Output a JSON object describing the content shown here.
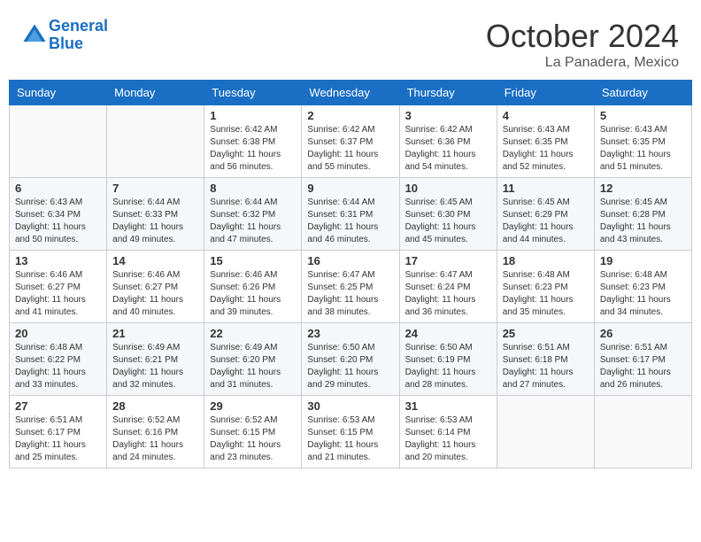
{
  "header": {
    "logo_line1": "General",
    "logo_line2": "Blue",
    "month": "October 2024",
    "location": "La Panadera, Mexico"
  },
  "days_of_week": [
    "Sunday",
    "Monday",
    "Tuesday",
    "Wednesday",
    "Thursday",
    "Friday",
    "Saturday"
  ],
  "weeks": [
    [
      {
        "day": "",
        "info": ""
      },
      {
        "day": "",
        "info": ""
      },
      {
        "day": "1",
        "info": "Sunrise: 6:42 AM\nSunset: 6:38 PM\nDaylight: 11 hours and 56 minutes."
      },
      {
        "day": "2",
        "info": "Sunrise: 6:42 AM\nSunset: 6:37 PM\nDaylight: 11 hours and 55 minutes."
      },
      {
        "day": "3",
        "info": "Sunrise: 6:42 AM\nSunset: 6:36 PM\nDaylight: 11 hours and 54 minutes."
      },
      {
        "day": "4",
        "info": "Sunrise: 6:43 AM\nSunset: 6:35 PM\nDaylight: 11 hours and 52 minutes."
      },
      {
        "day": "5",
        "info": "Sunrise: 6:43 AM\nSunset: 6:35 PM\nDaylight: 11 hours and 51 minutes."
      }
    ],
    [
      {
        "day": "6",
        "info": "Sunrise: 6:43 AM\nSunset: 6:34 PM\nDaylight: 11 hours and 50 minutes."
      },
      {
        "day": "7",
        "info": "Sunrise: 6:44 AM\nSunset: 6:33 PM\nDaylight: 11 hours and 49 minutes."
      },
      {
        "day": "8",
        "info": "Sunrise: 6:44 AM\nSunset: 6:32 PM\nDaylight: 11 hours and 47 minutes."
      },
      {
        "day": "9",
        "info": "Sunrise: 6:44 AM\nSunset: 6:31 PM\nDaylight: 11 hours and 46 minutes."
      },
      {
        "day": "10",
        "info": "Sunrise: 6:45 AM\nSunset: 6:30 PM\nDaylight: 11 hours and 45 minutes."
      },
      {
        "day": "11",
        "info": "Sunrise: 6:45 AM\nSunset: 6:29 PM\nDaylight: 11 hours and 44 minutes."
      },
      {
        "day": "12",
        "info": "Sunrise: 6:45 AM\nSunset: 6:28 PM\nDaylight: 11 hours and 43 minutes."
      }
    ],
    [
      {
        "day": "13",
        "info": "Sunrise: 6:46 AM\nSunset: 6:27 PM\nDaylight: 11 hours and 41 minutes."
      },
      {
        "day": "14",
        "info": "Sunrise: 6:46 AM\nSunset: 6:27 PM\nDaylight: 11 hours and 40 minutes."
      },
      {
        "day": "15",
        "info": "Sunrise: 6:46 AM\nSunset: 6:26 PM\nDaylight: 11 hours and 39 minutes."
      },
      {
        "day": "16",
        "info": "Sunrise: 6:47 AM\nSunset: 6:25 PM\nDaylight: 11 hours and 38 minutes."
      },
      {
        "day": "17",
        "info": "Sunrise: 6:47 AM\nSunset: 6:24 PM\nDaylight: 11 hours and 36 minutes."
      },
      {
        "day": "18",
        "info": "Sunrise: 6:48 AM\nSunset: 6:23 PM\nDaylight: 11 hours and 35 minutes."
      },
      {
        "day": "19",
        "info": "Sunrise: 6:48 AM\nSunset: 6:23 PM\nDaylight: 11 hours and 34 minutes."
      }
    ],
    [
      {
        "day": "20",
        "info": "Sunrise: 6:48 AM\nSunset: 6:22 PM\nDaylight: 11 hours and 33 minutes."
      },
      {
        "day": "21",
        "info": "Sunrise: 6:49 AM\nSunset: 6:21 PM\nDaylight: 11 hours and 32 minutes."
      },
      {
        "day": "22",
        "info": "Sunrise: 6:49 AM\nSunset: 6:20 PM\nDaylight: 11 hours and 31 minutes."
      },
      {
        "day": "23",
        "info": "Sunrise: 6:50 AM\nSunset: 6:20 PM\nDaylight: 11 hours and 29 minutes."
      },
      {
        "day": "24",
        "info": "Sunrise: 6:50 AM\nSunset: 6:19 PM\nDaylight: 11 hours and 28 minutes."
      },
      {
        "day": "25",
        "info": "Sunrise: 6:51 AM\nSunset: 6:18 PM\nDaylight: 11 hours and 27 minutes."
      },
      {
        "day": "26",
        "info": "Sunrise: 6:51 AM\nSunset: 6:17 PM\nDaylight: 11 hours and 26 minutes."
      }
    ],
    [
      {
        "day": "27",
        "info": "Sunrise: 6:51 AM\nSunset: 6:17 PM\nDaylight: 11 hours and 25 minutes."
      },
      {
        "day": "28",
        "info": "Sunrise: 6:52 AM\nSunset: 6:16 PM\nDaylight: 11 hours and 24 minutes."
      },
      {
        "day": "29",
        "info": "Sunrise: 6:52 AM\nSunset: 6:15 PM\nDaylight: 11 hours and 23 minutes."
      },
      {
        "day": "30",
        "info": "Sunrise: 6:53 AM\nSunset: 6:15 PM\nDaylight: 11 hours and 21 minutes."
      },
      {
        "day": "31",
        "info": "Sunrise: 6:53 AM\nSunset: 6:14 PM\nDaylight: 11 hours and 20 minutes."
      },
      {
        "day": "",
        "info": ""
      },
      {
        "day": "",
        "info": ""
      }
    ]
  ]
}
